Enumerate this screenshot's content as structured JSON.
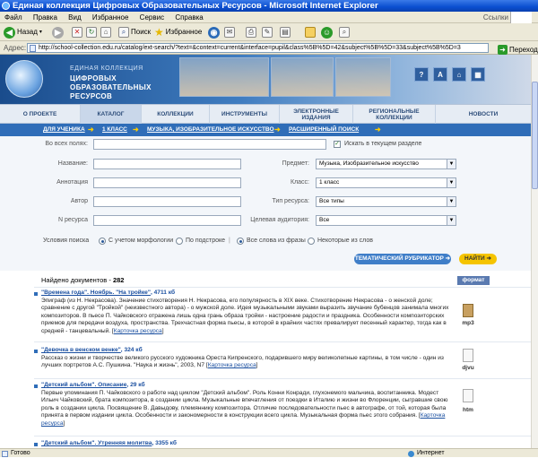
{
  "window": {
    "title": "Единая коллекция Цифровых Образовательных Ресурсов - Microsoft Internet Explorer"
  },
  "menu": {
    "items": [
      "Файл",
      "Правка",
      "Вид",
      "Избранное",
      "Сервис",
      "Справка"
    ],
    "links": "Ссылки"
  },
  "toolbar": {
    "back": "Назад",
    "search": "Поиск",
    "favorites": "Избранное"
  },
  "address": {
    "label": "Адрес:",
    "url": "http://school-collection.edu.ru/catalog/ext-search/?text=&context=current&interface=pupil&class%5B%5D=42&subject%5B%5D=33&subject%5B%5D=3",
    "go": "Переход"
  },
  "site": {
    "brand_top": "ЕДИНАЯ КОЛЛЕКЦИЯ",
    "brand_main": "ЦИФРОВЫХ ОБРАЗОВАТЕЛЬНЫХ РЕСУРСОВ",
    "header_buttons": [
      "?",
      "A"
    ],
    "nav": [
      "О ПРОЕКТЕ",
      "КАТАЛОГ",
      "КОЛЛЕКЦИИ",
      "ИНСТРУМЕНТЫ",
      "ЭЛЕКТРОННЫЕ ИЗДАНИЯ",
      "РЕГИОНАЛЬНЫЕ КОЛЛЕКЦИИ",
      "НОВОСТИ"
    ],
    "breadcrumbs": [
      "ДЛЯ УЧЕНИКА",
      "1 КЛАСС",
      "МУЗЫКА, ИЗОБРАЗИТЕЛЬНОЕ ИСКУССТВО",
      "РАСШИРЕННЫЙ ПОИСК"
    ]
  },
  "form": {
    "all_fields_label": "Во всех полях:",
    "search_in_section": "Искать в текущем разделе",
    "title_label": "Название:",
    "annotation_label": "Аннотация",
    "author_label": "Автор",
    "resource_no_label": "N ресурса",
    "subject_label": "Предмет:",
    "subject_value": "Музыка, Изобразительное искусство",
    "class_label": "Класс:",
    "class_value": "1 класс",
    "type_label": "Тип ресурса:",
    "type_value": "Все типы",
    "audience_label": "Целевая аудитория:",
    "audience_value": "Все",
    "conditions_label": "Условия поиска",
    "radio_morph": "С учетом морфологии",
    "radio_substring": "По подстроке",
    "radio_all_words": "Все слова из фразы",
    "radio_some_words": "Некоторые из слов",
    "rubricator_btn": "ТЕМАТИЧЕСКИЙ РУБРИКАТОР",
    "find_btn": "НАЙТИ"
  },
  "results": {
    "found_label": "Найдено документов - ",
    "found_count": "282",
    "format_header": "формат",
    "card_link": "Карточка ресурса",
    "items": [
      {
        "title": "\"Времена года\". Ноябрь. \"На тройке\"",
        "size": ", 4711 кб",
        "text": "Эпиграф (из Н. Некрасова). Значение стихотворения Н. Некрасова, его популярность в XIX веке. Стихотворение Некрасова - о женской доле; сравнение с другой \"Тройкой\" (неизвестного автора) - о мужской доле. Идея музыкальными звуками выразить звучание бубенцов занимала многих композиторов. В пьесе П. Чайковского отражена лишь одна грань образа тройки - настроение радости и праздника. Особенности композиторских приемов для передачи воздуха, пространства. Трехчастная форма пьесы, в которой в крайних частях превалирует песенный характер, тогда как в средней - танцевальный.",
        "format": "mp3"
      },
      {
        "title": "\"Девочка в венском венке\"",
        "size": ", 324 кб",
        "text": "Рассказ о жизни и творчестве великого русского художника Ореста Кипренского, подарившего миру великолепные картины, в том числе - один из лучших портретов А.С. Пушкина. \"Наука и жизнь\", 2003, N7",
        "format": "djvu"
      },
      {
        "title": "\"Детский альбом\". Описание",
        "size": ", 29 кб",
        "text": "Первые упоминания П. Чайковского о работе над циклом \"Детский альбом\". Роль Конни Конради, глухонемого мальчика, воспитанника. Модест Ильич Чайковский, брата композитора, в создании цикла. Музыкальные впечатления от поездки в Италию и жизни во Флоренции, сыгравшие свою роль в создании цикла. Посвящение В. Давыдову, племяннику композитора. Отличие последовательности пьес в автографе, от той, которая была принята в первом издании цикла. Особенности и закономерности в конструкции всего цикла. Музыкальная форма пьес этого собрания.",
        "format": "htm"
      },
      {
        "title": "\"Детский альбом\". Утренняя молитва",
        "size": ", 3355 кб",
        "text": "",
        "format": ""
      }
    ]
  },
  "status": {
    "ready": "Готово",
    "zone": "Интернет"
  },
  "colors": {
    "title_bar": "#0a4fd0",
    "crumb_bar": "#2f6db8",
    "link": "#1a4fa0",
    "find_button": "#f5c400"
  }
}
